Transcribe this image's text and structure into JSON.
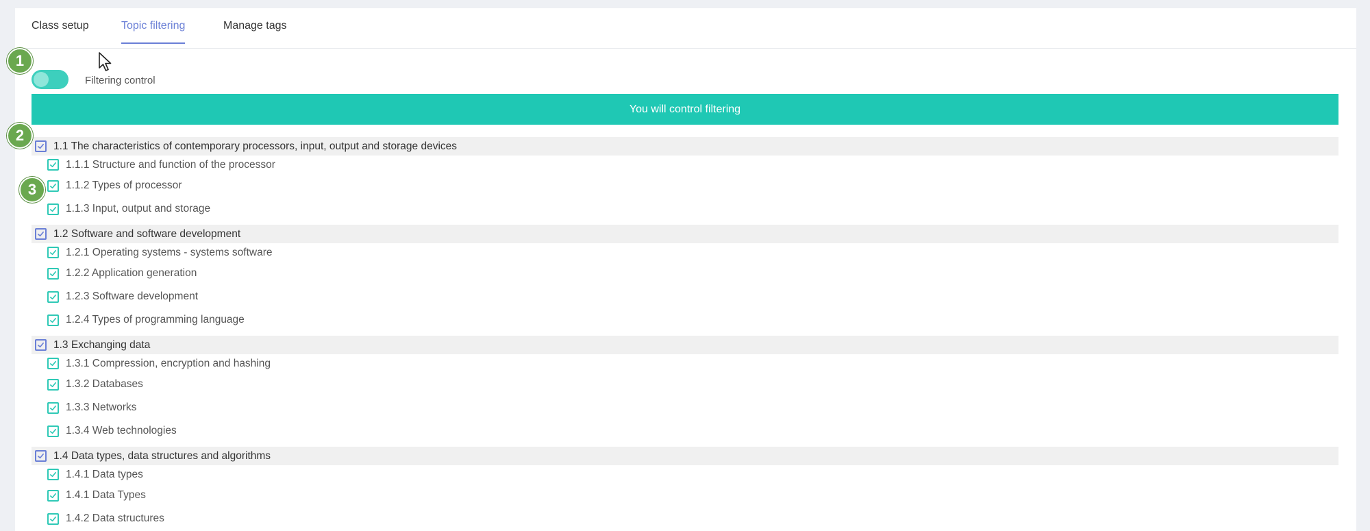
{
  "tabs": [
    {
      "label": "Class setup",
      "active": false
    },
    {
      "label": "Topic filtering",
      "active": true
    },
    {
      "label": "Manage tags",
      "active": false
    }
  ],
  "filter": {
    "toggle_on": true,
    "label": "Filtering control",
    "banner": "You will control filtering"
  },
  "badges": [
    "1",
    "2",
    "3"
  ],
  "colors": {
    "accent_blue": "#6a7fd6",
    "teal": "#1fc8b4",
    "badge_green": "#6aa84f"
  },
  "topics": [
    {
      "label": "1.1 The characteristics of contemporary processors, input, output and storage devices",
      "checked": true,
      "children": [
        {
          "label": "1.1.1 Structure and function of the processor",
          "checked": true
        },
        {
          "label": "1.1.2 Types of processor",
          "checked": true
        },
        {
          "label": "1.1.3 Input, output and storage",
          "checked": true
        }
      ]
    },
    {
      "label": "1.2 Software and software development",
      "checked": true,
      "children": [
        {
          "label": "1.2.1 Operating systems - systems software",
          "checked": true
        },
        {
          "label": "1.2.2 Application generation",
          "checked": true
        },
        {
          "label": "1.2.3 Software development",
          "checked": true
        },
        {
          "label": "1.2.4 Types of programming language",
          "checked": true
        }
      ]
    },
    {
      "label": "1.3 Exchanging data",
      "checked": true,
      "children": [
        {
          "label": "1.3.1 Compression, encryption and hashing",
          "checked": true
        },
        {
          "label": "1.3.2 Databases",
          "checked": true
        },
        {
          "label": "1.3.3 Networks",
          "checked": true
        },
        {
          "label": "1.3.4 Web technologies",
          "checked": true
        }
      ]
    },
    {
      "label": "1.4 Data types, data structures and algorithms",
      "checked": true,
      "children": [
        {
          "label": "1.4.1 Data types",
          "checked": true
        },
        {
          "label": "1.4.1 Data Types",
          "checked": true
        },
        {
          "label": "1.4.2 Data structures",
          "checked": true
        }
      ]
    }
  ]
}
